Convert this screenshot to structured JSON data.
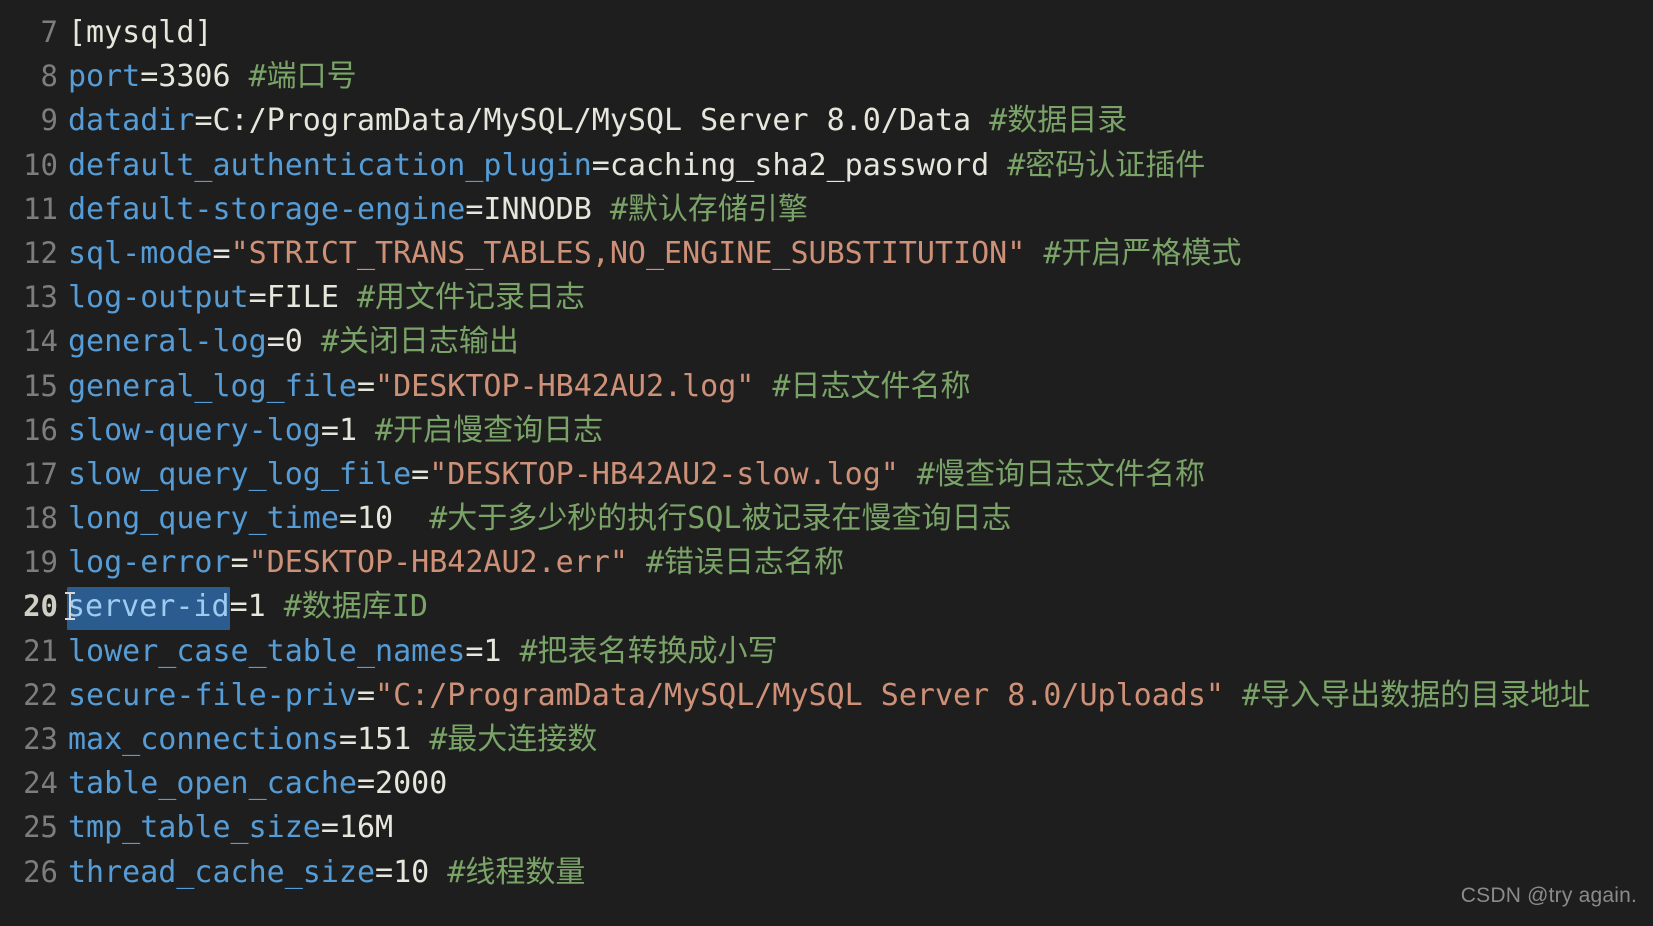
{
  "editor": {
    "theme": "dark",
    "background": "#1e1e1e",
    "language": "ini",
    "colors": {
      "key": "#569cd6",
      "value": "#e6e6dc",
      "string": "#ce9178",
      "comment": "#7aa368",
      "line_number": "#7d7d7d",
      "line_number_active": "#cfcfc4",
      "selection": "#2a5c8f"
    },
    "active_line": 20,
    "selection_text": "server-id"
  },
  "lines": [
    {
      "number": "7",
      "tokens": [
        {
          "type": "section",
          "text": "[mysqld]"
        }
      ]
    },
    {
      "number": "8",
      "tokens": [
        {
          "type": "key",
          "text": "port"
        },
        {
          "type": "punct",
          "text": "="
        },
        {
          "type": "val",
          "text": "3306"
        },
        {
          "type": "comment",
          "text": " #端口号"
        }
      ]
    },
    {
      "number": "9",
      "tokens": [
        {
          "type": "key",
          "text": "datadir"
        },
        {
          "type": "punct",
          "text": "="
        },
        {
          "type": "val",
          "text": "C:/ProgramData/MySQL/MySQL Server 8.0/Data"
        },
        {
          "type": "comment",
          "text": " #数据目录"
        }
      ]
    },
    {
      "number": "10",
      "tokens": [
        {
          "type": "key",
          "text": "default_authentication_plugin"
        },
        {
          "type": "punct",
          "text": "="
        },
        {
          "type": "val",
          "text": "caching_sha2_password"
        },
        {
          "type": "comment",
          "text": " #密码认证插件"
        }
      ]
    },
    {
      "number": "11",
      "tokens": [
        {
          "type": "key",
          "text": "default-storage-engine"
        },
        {
          "type": "punct",
          "text": "="
        },
        {
          "type": "val",
          "text": "INNODB"
        },
        {
          "type": "comment",
          "text": " #默认存储引擎"
        }
      ]
    },
    {
      "number": "12",
      "tokens": [
        {
          "type": "key",
          "text": "sql-mode"
        },
        {
          "type": "punct",
          "text": "="
        },
        {
          "type": "str",
          "text": "\"STRICT_TRANS_TABLES,NO_ENGINE_SUBSTITUTION\""
        },
        {
          "type": "comment",
          "text": " #开启严格模式"
        }
      ]
    },
    {
      "number": "13",
      "tokens": [
        {
          "type": "key",
          "text": "log-output"
        },
        {
          "type": "punct",
          "text": "="
        },
        {
          "type": "val",
          "text": "FILE"
        },
        {
          "type": "comment",
          "text": " #用文件记录日志"
        }
      ]
    },
    {
      "number": "14",
      "tokens": [
        {
          "type": "key",
          "text": "general-log"
        },
        {
          "type": "punct",
          "text": "="
        },
        {
          "type": "val",
          "text": "0"
        },
        {
          "type": "comment",
          "text": " #关闭日志输出"
        }
      ]
    },
    {
      "number": "15",
      "tokens": [
        {
          "type": "key",
          "text": "general_log_file"
        },
        {
          "type": "punct",
          "text": "="
        },
        {
          "type": "str",
          "text": "\"DESKTOP-HB42AU2.log\""
        },
        {
          "type": "comment",
          "text": " #日志文件名称"
        }
      ]
    },
    {
      "number": "16",
      "tokens": [
        {
          "type": "key",
          "text": "slow-query-log"
        },
        {
          "type": "punct",
          "text": "="
        },
        {
          "type": "val",
          "text": "1"
        },
        {
          "type": "comment",
          "text": " #开启慢查询日志"
        }
      ]
    },
    {
      "number": "17",
      "tokens": [
        {
          "type": "key",
          "text": "slow_query_log_file"
        },
        {
          "type": "punct",
          "text": "="
        },
        {
          "type": "str",
          "text": "\"DESKTOP-HB42AU2-slow.log\""
        },
        {
          "type": "comment",
          "text": " #慢查询日志文件名称"
        }
      ]
    },
    {
      "number": "18",
      "tokens": [
        {
          "type": "key",
          "text": "long_query_time"
        },
        {
          "type": "punct",
          "text": "="
        },
        {
          "type": "val",
          "text": "10"
        },
        {
          "type": "comment",
          "text": "  #大于多少秒的执行SQL被记录在慢查询日志"
        }
      ]
    },
    {
      "number": "19",
      "tokens": [
        {
          "type": "key",
          "text": "log-error"
        },
        {
          "type": "punct",
          "text": "="
        },
        {
          "type": "str",
          "text": "\"DESKTOP-HB42AU2.err\""
        },
        {
          "type": "comment",
          "text": " #错误日志名称"
        }
      ]
    },
    {
      "number": "20",
      "active": true,
      "tokens": [
        {
          "type": "caret",
          "text": ""
        },
        {
          "type": "key",
          "text": "server-id",
          "selected": true
        },
        {
          "type": "punct",
          "text": "="
        },
        {
          "type": "val",
          "text": "1"
        },
        {
          "type": "comment",
          "text": " #数据库ID"
        }
      ]
    },
    {
      "number": "21",
      "tokens": [
        {
          "type": "key",
          "text": "lower_case_table_names"
        },
        {
          "type": "punct",
          "text": "="
        },
        {
          "type": "val",
          "text": "1"
        },
        {
          "type": "comment",
          "text": " #把表名转换成小写"
        }
      ]
    },
    {
      "number": "22",
      "tokens": [
        {
          "type": "key",
          "text": "secure-file-priv"
        },
        {
          "type": "punct",
          "text": "="
        },
        {
          "type": "str",
          "text": "\"C:/ProgramData/MySQL/MySQL Server 8.0/Uploads\""
        },
        {
          "type": "comment",
          "text": " #导入导出数据的目录地址"
        }
      ]
    },
    {
      "number": "23",
      "tokens": [
        {
          "type": "key",
          "text": "max_connections"
        },
        {
          "type": "punct",
          "text": "="
        },
        {
          "type": "val",
          "text": "151"
        },
        {
          "type": "comment",
          "text": " #最大连接数"
        }
      ]
    },
    {
      "number": "24",
      "tokens": [
        {
          "type": "key",
          "text": "table_open_cache"
        },
        {
          "type": "punct",
          "text": "="
        },
        {
          "type": "val",
          "text": "2000"
        }
      ]
    },
    {
      "number": "25",
      "tokens": [
        {
          "type": "key",
          "text": "tmp_table_size"
        },
        {
          "type": "punct",
          "text": "="
        },
        {
          "type": "val",
          "text": "16M"
        }
      ]
    },
    {
      "number": "26",
      "tokens": [
        {
          "type": "key",
          "text": "thread_cache_size"
        },
        {
          "type": "punct",
          "text": "="
        },
        {
          "type": "val",
          "text": "10"
        },
        {
          "type": "comment",
          "text": " #线程数量"
        }
      ]
    }
  ],
  "watermark": {
    "text": "CSDN @try again."
  }
}
